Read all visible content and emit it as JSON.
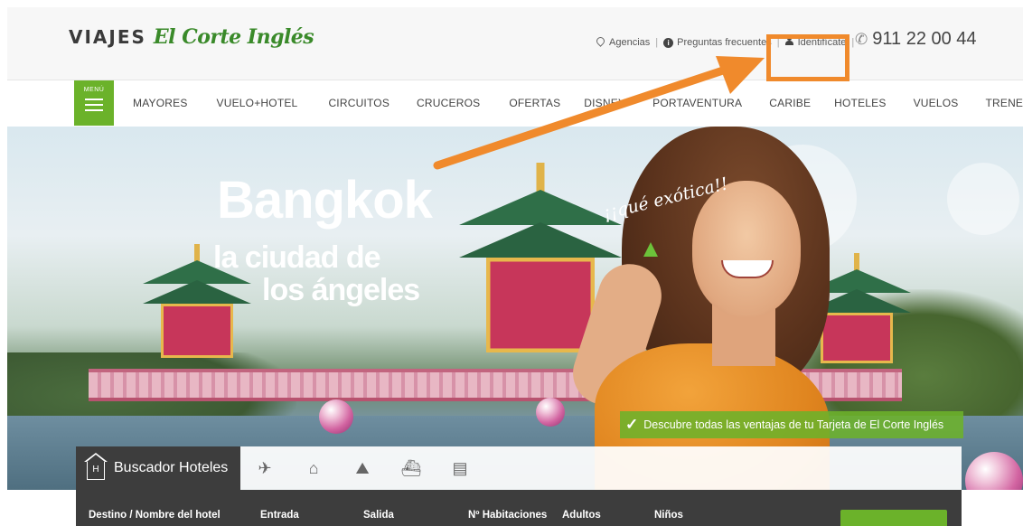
{
  "header": {
    "logo_viajes": "VIAJES",
    "logo_brand": "El Corte Inglés",
    "links": {
      "agencias": "Agencias",
      "preguntas": "Preguntas frecuentes",
      "identificate": "Identifícate"
    },
    "phone": "911 22 00 44"
  },
  "nav": {
    "menu_label": "MENÚ",
    "items": [
      "MAYORES",
      "VUELO+HOTEL",
      "CIRCUITOS",
      "CRUCEROS",
      "OFERTAS",
      "DISNEY",
      "PORTAVENTURA",
      "CARIBE",
      "HOTELES",
      "VUELOS",
      "TRENES"
    ]
  },
  "hero": {
    "title": "Bangkok",
    "subtitle_line1": "la ciudad de",
    "subtitle_line2": "los ángeles",
    "tagline": "¡¡qué exótica!!",
    "promo": "Descubre todas las ventajas de tu Tarjeta de El Corte Inglés"
  },
  "search": {
    "active_tab": "Buscador Hoteles",
    "tab_icons": [
      "flight-hotel-icon",
      "hotel-icon",
      "circuit-icon",
      "cruise-icon",
      "train-icon"
    ],
    "columns": {
      "destino": "Destino / Nombre del hotel",
      "entrada": "Entrada",
      "salida": "Salida",
      "habitaciones": "Nº Habitaciones",
      "adultos": "Adultos",
      "ninos": "Niños"
    }
  },
  "colors": {
    "brand_green": "#6bb22a",
    "highlight_orange": "#f08a2c",
    "dark_panel": "#3d3d3d"
  }
}
